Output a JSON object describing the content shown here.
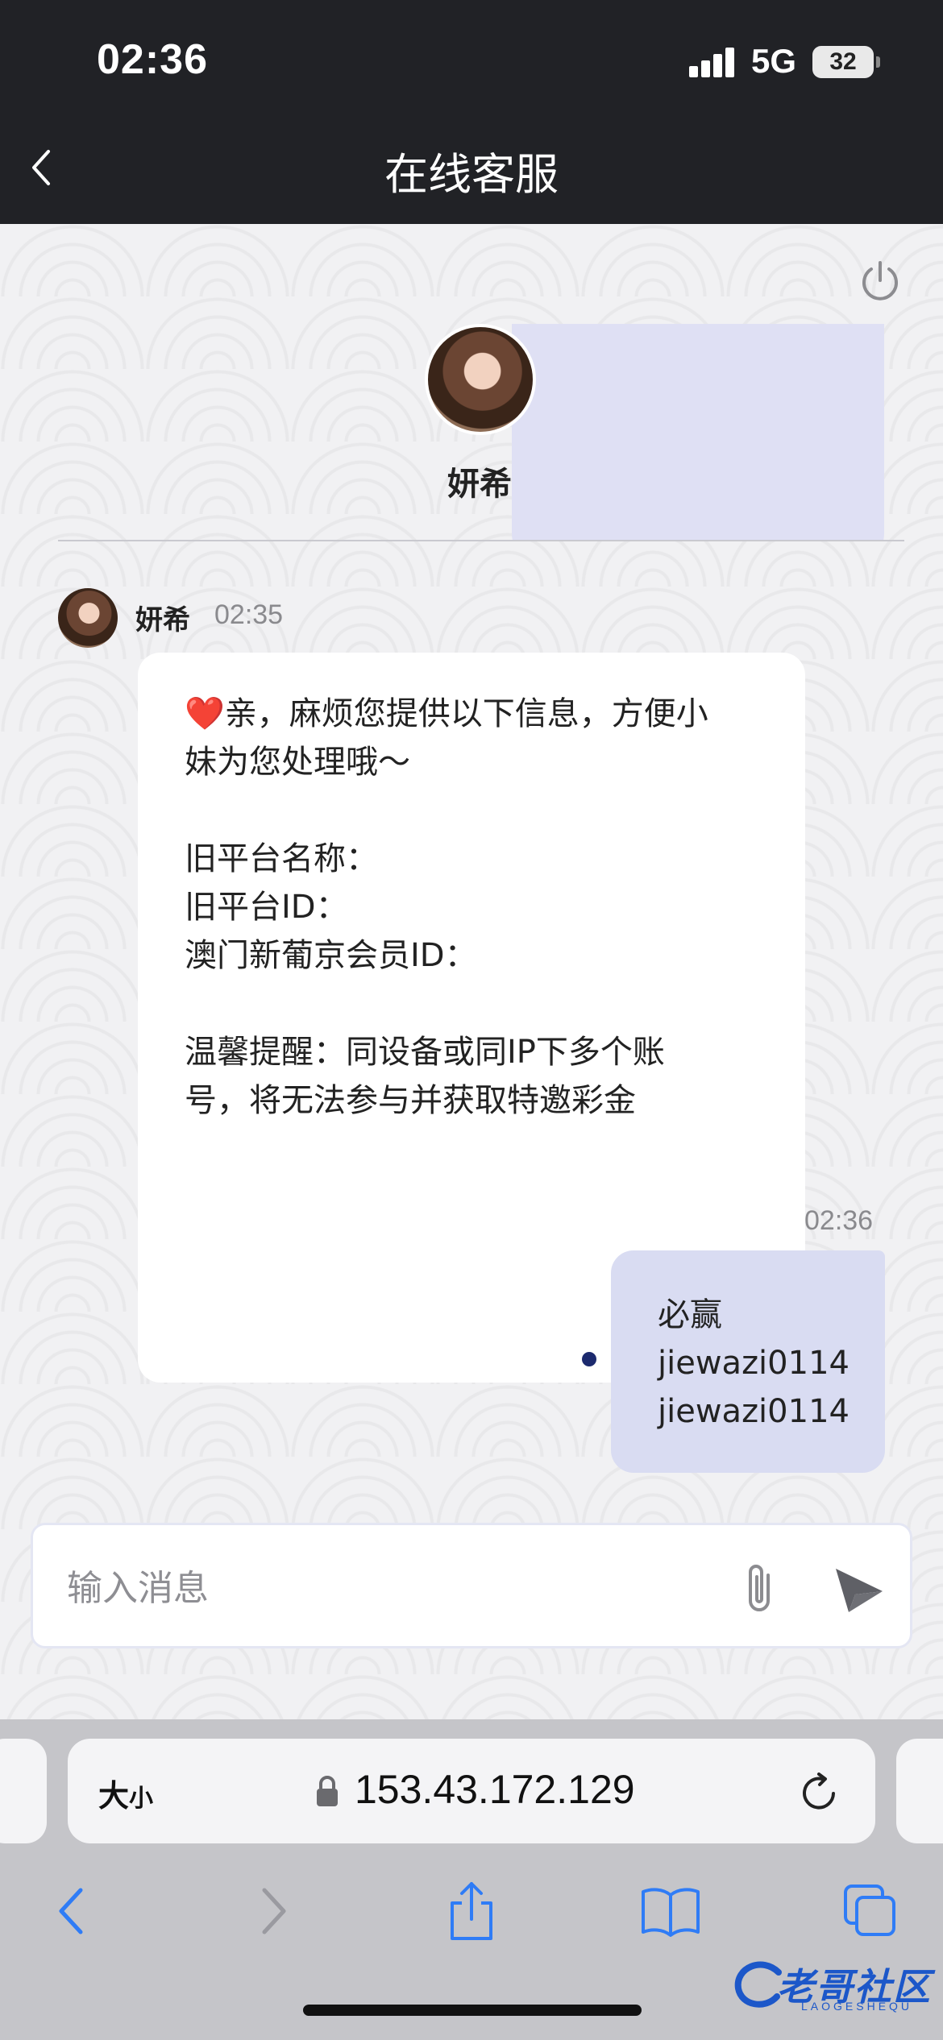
{
  "status_bar": {
    "time": "02:36",
    "network": "5G",
    "battery": "32"
  },
  "header": {
    "title": "在线客服",
    "back_icon": "chevron-left-icon"
  },
  "agent": {
    "name": "妍希"
  },
  "messages": {
    "incoming": {
      "sender": "妍希",
      "time": "02:35",
      "heart": "❤️",
      "lines": [
        "亲，麻烦您提供以下信息，方便小",
        "妹为您处理哦～",
        "",
        "旧平台名称：",
        "旧平台ID：",
        "澳门新葡京会员ID：",
        "",
        "温馨提醒：同设备或同IP下多个账",
        "号，将无法参与并获取特邀彩金"
      ]
    },
    "outgoing": {
      "time": "02:36",
      "lines": [
        "必赢",
        "jiewazi0114",
        "jiewazi0114"
      ]
    }
  },
  "composer": {
    "placeholder": "输入消息",
    "value": "",
    "attach_icon": "paperclip-icon",
    "send_icon": "send-icon"
  },
  "browser": {
    "text_size_label_big": "大",
    "text_size_label_small": "小",
    "url": "153.43.172.129",
    "icons": [
      "back-icon",
      "forward-icon",
      "share-icon",
      "bookmarks-icon",
      "tabs-icon"
    ]
  },
  "watermark": {
    "text": "老哥社区",
    "sub": "LAOGESHEQU"
  },
  "colors": {
    "header_bg": "#212226",
    "outgoing_bubble": "#d9dcf2",
    "incoming_bubble": "#ffffff",
    "ios_blue": "#2f7cf6",
    "heart_red": "#e0303e"
  }
}
